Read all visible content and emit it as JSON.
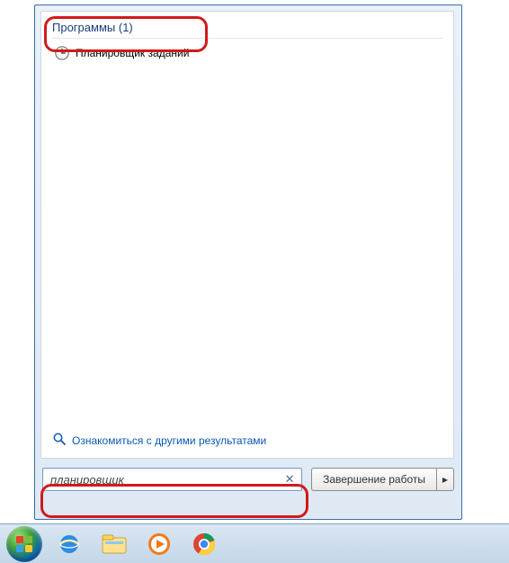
{
  "header": {
    "programs_label": "Программы",
    "count_suffix": "(1)"
  },
  "results": [
    {
      "label": "Планировщик заданий",
      "icon": "clock-icon"
    }
  ],
  "more_results_label": "Ознакомиться с другими результатами",
  "search": {
    "value": "планировщик"
  },
  "shutdown": {
    "label": "Завершение работы"
  },
  "taskbar": {
    "items": [
      "start",
      "ie",
      "explorer",
      "wmp",
      "chrome"
    ]
  }
}
